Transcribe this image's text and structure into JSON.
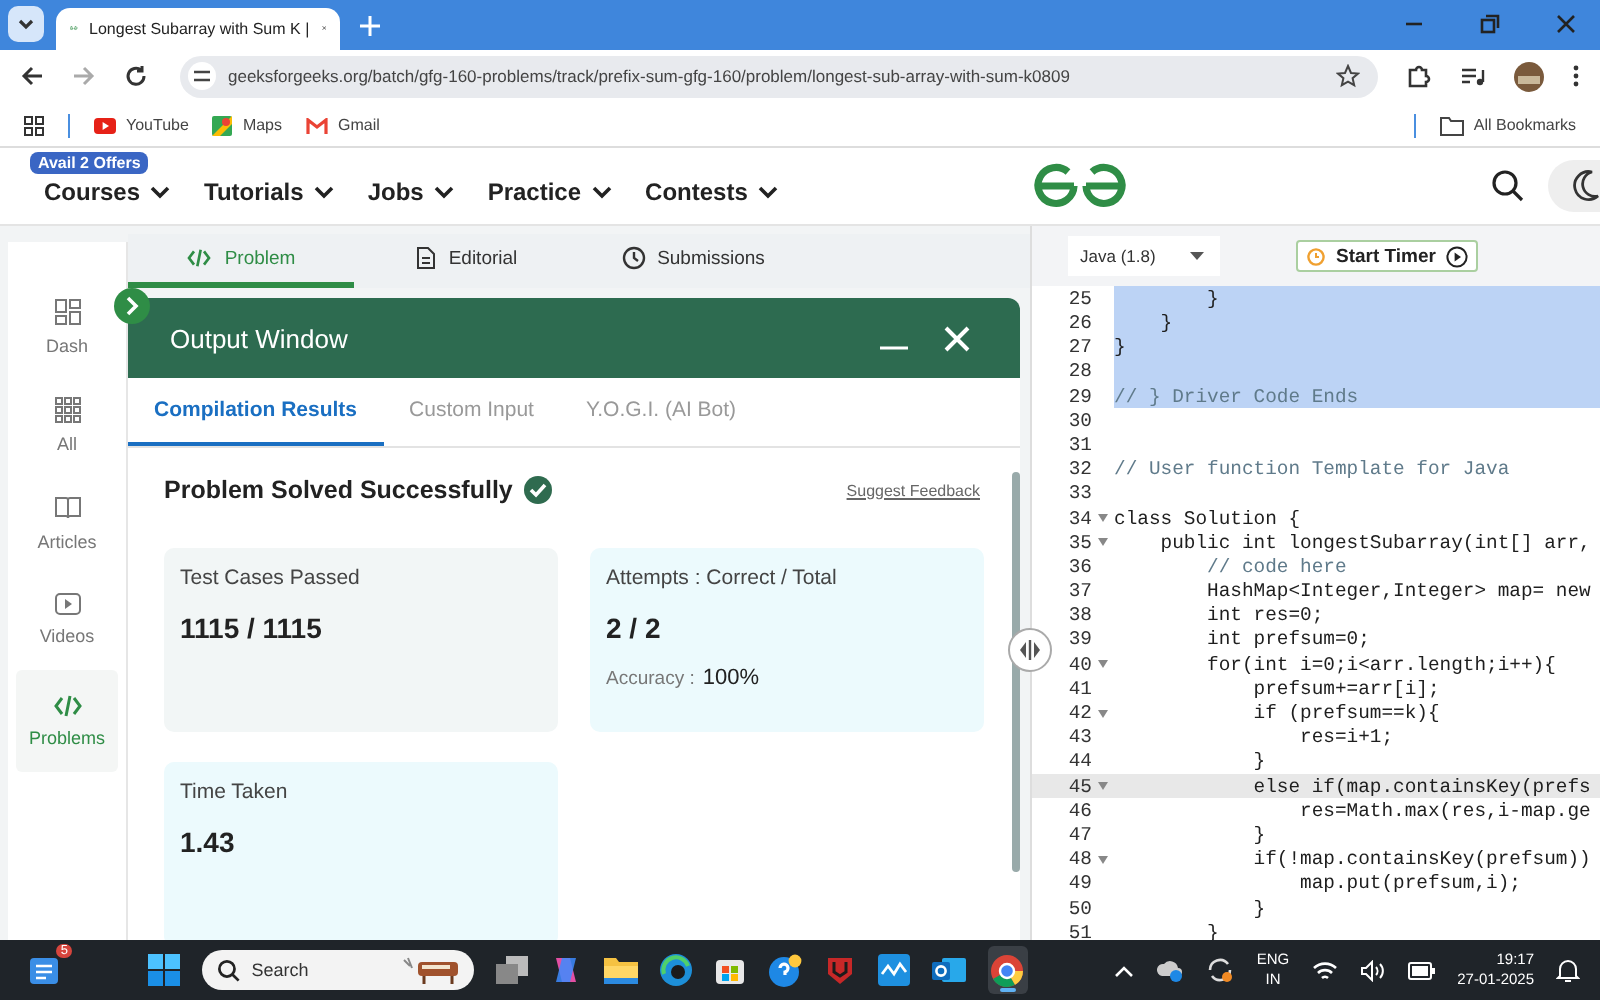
{
  "browser": {
    "tab_title": "Longest Subarray with Sum K |",
    "url": "geeksforgeeks.org/batch/gfg-160-problems/track/prefix-sum-gfg-160/problem/longest-sub-array-with-sum-k0809",
    "bookmarks": [
      "YouTube",
      "Maps",
      "Gmail"
    ],
    "all_bookmarks": "All Bookmarks"
  },
  "site_nav": {
    "offer_badge": "Avail 2 Offers",
    "items": [
      "Courses",
      "Tutorials",
      "Jobs",
      "Practice",
      "Contests"
    ]
  },
  "sidebar": {
    "items": [
      {
        "label": "Dash",
        "kind": "dash",
        "selected": false
      },
      {
        "label": "All",
        "kind": "all",
        "selected": false
      },
      {
        "label": "Articles",
        "kind": "articles",
        "selected": false
      },
      {
        "label": "Videos",
        "kind": "videos",
        "selected": false
      },
      {
        "label": "Problems",
        "kind": "problems",
        "selected": true
      }
    ]
  },
  "problem_tabs": [
    {
      "label": "Problem",
      "kind": "problem",
      "selected": true
    },
    {
      "label": "Editorial",
      "kind": "editorial",
      "selected": false
    },
    {
      "label": "Submissions",
      "kind": "submissions",
      "selected": false
    }
  ],
  "output_window": {
    "title": "Output Window",
    "tabs": [
      {
        "label": "Compilation Results",
        "selected": true
      },
      {
        "label": "Custom Input",
        "selected": false
      },
      {
        "label": "Y.O.G.I. (AI Bot)",
        "selected": false
      }
    ],
    "status": "Problem Solved Successfully",
    "feedback_link": "Suggest Feedback",
    "cards": [
      {
        "label": "Test Cases Passed",
        "value": "1115 / 1115",
        "color": "#f2f6f6"
      },
      {
        "label": "Attempts : Correct / Total",
        "value": "2 / 2",
        "note_label": "Accuracy :",
        "note_value": "100%",
        "color": "#ecfafd"
      },
      {
        "label": "Time Taken",
        "value": "1.43",
        "color": "#ecfafd"
      }
    ]
  },
  "editor": {
    "language": "Java (1.8)",
    "timer_button": "Start Timer",
    "lines": [
      {
        "number": "25",
        "text": "        }",
        "kind": "code",
        "selected": true,
        "active": false,
        "foldable": false
      },
      {
        "number": "26",
        "text": "    }",
        "kind": "code",
        "selected": true,
        "active": false,
        "foldable": false
      },
      {
        "number": "27",
        "text": "}",
        "kind": "code",
        "selected": true,
        "active": false,
        "foldable": false
      },
      {
        "number": "28",
        "selected": true,
        "active": false,
        "foldable": false
      },
      {
        "number": "29",
        "text": "// } Driver Code Ends",
        "kind": "comment",
        "selected": true,
        "active": false,
        "foldable": false
      },
      {
        "number": "30",
        "selected": false,
        "active": false,
        "foldable": false
      },
      {
        "number": "31",
        "selected": false,
        "active": false,
        "foldable": false
      },
      {
        "number": "32",
        "text": "// User function Template for Java",
        "kind": "comment",
        "selected": false,
        "active": false,
        "foldable": false
      },
      {
        "number": "33",
        "selected": false,
        "active": false,
        "foldable": false
      },
      {
        "number": "34",
        "text": "class Solution {",
        "kind": "code",
        "selected": false,
        "active": false,
        "foldable": true
      },
      {
        "number": "35",
        "text": "    public int longestSubarray(int[] arr,",
        "kind": "code",
        "selected": false,
        "active": false,
        "foldable": true
      },
      {
        "number": "36",
        "text": "        // code here",
        "kind": "comment",
        "selected": false,
        "active": false,
        "foldable": false
      },
      {
        "number": "37",
        "text": "        HashMap<Integer,Integer> map= new",
        "kind": "code",
        "selected": false,
        "active": false,
        "foldable": false
      },
      {
        "number": "38",
        "text": "        int res=0;",
        "kind": "code",
        "selected": false,
        "active": false,
        "foldable": false
      },
      {
        "number": "39",
        "text": "        int prefsum=0;",
        "kind": "code",
        "selected": false,
        "active": false,
        "foldable": false
      },
      {
        "number": "40",
        "text": "        for(int i=0;i<arr.length;i++){",
        "kind": "code",
        "selected": false,
        "active": false,
        "foldable": true
      },
      {
        "number": "41",
        "text": "            prefsum+=arr[i];",
        "kind": "code",
        "selected": false,
        "active": false,
        "foldable": false
      },
      {
        "number": "42",
        "text": "            if (prefsum==k){",
        "kind": "code",
        "selected": false,
        "active": false,
        "foldable": true
      },
      {
        "number": "43",
        "text": "                res=i+1;",
        "kind": "code",
        "selected": false,
        "active": false,
        "foldable": false
      },
      {
        "number": "44",
        "text": "            }",
        "kind": "code",
        "selected": false,
        "active": false,
        "foldable": false
      },
      {
        "number": "45",
        "text": "            else if(map.containsKey(prefs",
        "kind": "code",
        "selected": false,
        "active": true,
        "foldable": true
      },
      {
        "number": "46",
        "text": "                res=Math.max(res,i-map.ge",
        "kind": "code",
        "selected": false,
        "active": false,
        "foldable": false
      },
      {
        "number": "47",
        "text": "            }",
        "kind": "code",
        "selected": false,
        "active": false,
        "foldable": false
      },
      {
        "number": "48",
        "text": "            if(!map.containsKey(prefsum))",
        "kind": "code",
        "selected": false,
        "active": false,
        "foldable": true
      },
      {
        "number": "49",
        "text": "                map.put(prefsum,i);",
        "kind": "code",
        "selected": false,
        "active": false,
        "foldable": false
      },
      {
        "number": "50",
        "text": "            }",
        "kind": "code",
        "selected": false,
        "active": false,
        "foldable": false
      },
      {
        "number": "51",
        "text": "        }",
        "kind": "code",
        "selected": false,
        "active": false,
        "foldable": false
      }
    ]
  },
  "taskbar": {
    "widget_badge": "5",
    "search_placeholder": "Search",
    "language": "ENG",
    "region": "IN",
    "time": "19:17",
    "date": "27-01-2025"
  }
}
